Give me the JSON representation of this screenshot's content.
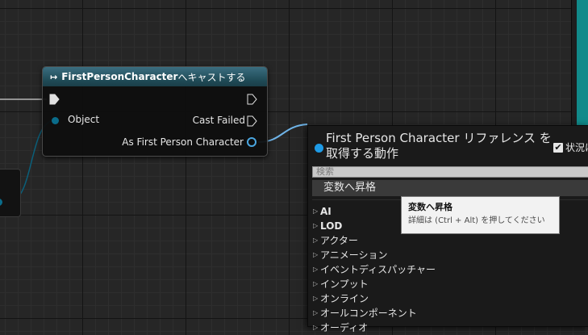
{
  "cast_node": {
    "title": "FirstPersonCharacter",
    "title_suffix": " へキャストする",
    "icon": "cast-arrow-icon",
    "inputs": [
      {
        "label": "Object"
      }
    ],
    "outputs": [
      {
        "label": "Cast Failed"
      },
      {
        "label": "As First Person Character"
      }
    ],
    "header_color": "#2d5e6c",
    "object_pin_color": "#0a6c8a",
    "output_pin_color": "#4aa6e0"
  },
  "action_menu": {
    "title": "First Person Character リファレンス を取得する動作",
    "context_sensitive_label": "状況に",
    "context_sensitive_checked": true,
    "search": {
      "placeholder": "検索",
      "value": ""
    },
    "selected_item": "変数へ昇格",
    "categories": [
      "AI",
      "LOD",
      "アクター",
      "アニメーション",
      "イベントディスパッチャー",
      "インプット",
      "オンライン",
      "オールコンポーネント",
      "オーディオ"
    ],
    "accent_color": "#1e9be6"
  },
  "tooltip": {
    "title": "変数へ昇格",
    "body": "詳細は (Ctrl + Alt) を押してください"
  }
}
